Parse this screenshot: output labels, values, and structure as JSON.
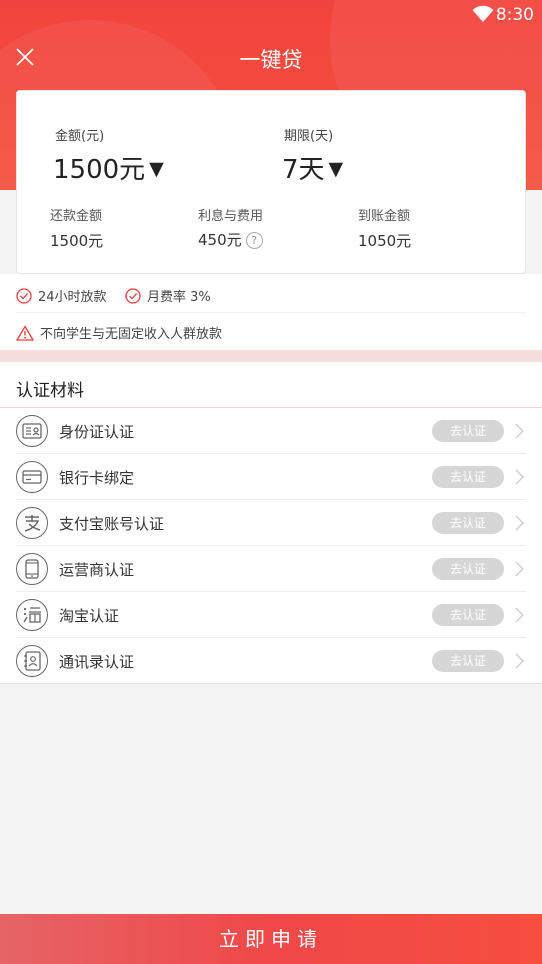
{
  "status_bar": {
    "time": "8:30",
    "wifi_icon": "wifi-icon"
  },
  "header": {
    "title": "一键贷",
    "close_icon": "close-icon"
  },
  "loan": {
    "amount_label": "金额(元)",
    "amount_value": "1500元",
    "term_label": "期限(天)",
    "term_value": "7天",
    "repay_label": "还款金额",
    "repay_value": "1500元",
    "fee_label": "利息与费用",
    "fee_value": "450元",
    "receive_label": "到账金额",
    "receive_value": "1050元"
  },
  "notes": {
    "badge1": "24小时放款",
    "badge2": "月费率 3%",
    "warning": "不向学生与无固定收入人群放款"
  },
  "materials": {
    "title": "认证材料",
    "items": [
      {
        "label": "身份证认证",
        "action": "去认证",
        "icon": "id-card-icon"
      },
      {
        "label": "银行卡绑定",
        "action": "去认证",
        "icon": "bank-card-icon"
      },
      {
        "label": "支付宝账号认证",
        "action": "去认证",
        "icon": "alipay-icon"
      },
      {
        "label": "运营商认证",
        "action": "去认证",
        "icon": "phone-icon"
      },
      {
        "label": "淘宝认证",
        "action": "去认证",
        "icon": "taobao-icon"
      },
      {
        "label": "通讯录认证",
        "action": "去认证",
        "icon": "contacts-icon"
      }
    ]
  },
  "footer": {
    "apply_label": "立即申请"
  },
  "colors": {
    "brand_red": "#f2443e",
    "button_gray": "#d6d6d6"
  }
}
